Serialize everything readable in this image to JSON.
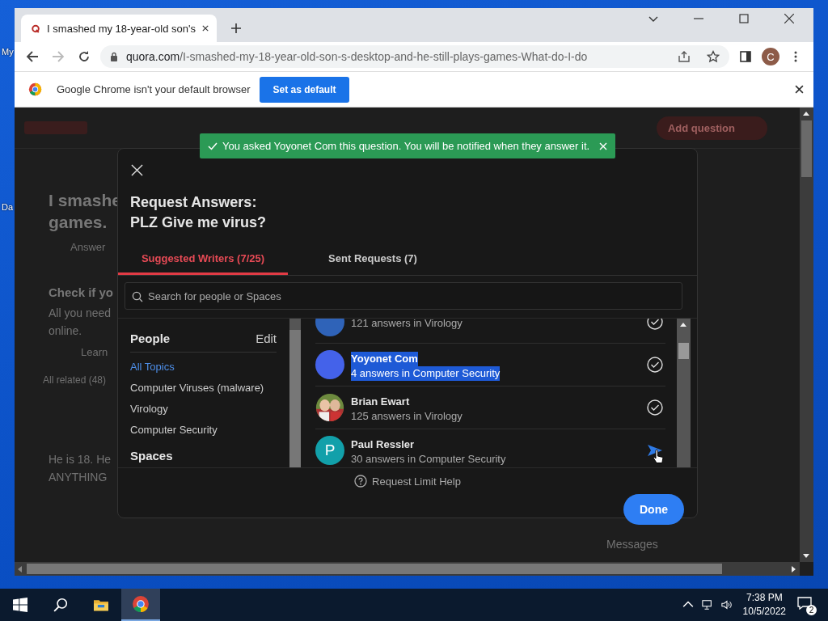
{
  "desktop": {
    "icon_labels": [
      "My",
      "Da"
    ]
  },
  "browser": {
    "tab": {
      "title": "I smashed my 18-year-old son's"
    },
    "address": {
      "domain": "quora.com",
      "path": "/I-smashed-my-18-year-old-son-s-desktop-and-he-still-plays-games-What-do-I-do"
    },
    "profile_initial": "C",
    "infobar": {
      "message": "Google Chrome isn't your default browser",
      "button": "Set as default"
    }
  },
  "page": {
    "header_button": "Add question",
    "messages_label": "Messages",
    "left_texts": [
      {
        "text": "I smashe",
        "kind": "title"
      },
      {
        "text": "games.",
        "kind": "title"
      },
      {
        "text": "Answer",
        "kind": "action"
      },
      {
        "text": "Check if yo",
        "kind": "heading"
      },
      {
        "text": "All you need",
        "kind": "body"
      },
      {
        "text": "online.",
        "kind": "body"
      },
      {
        "text": "Learn",
        "kind": "action"
      },
      {
        "text": "All related (48)",
        "kind": "small"
      },
      {
        "text": "He is 18. He",
        "kind": "body"
      },
      {
        "text": "ANYTHING",
        "kind": "body"
      }
    ]
  },
  "toast": {
    "message": "You asked Yoyonet Com this question. You will be notified when they answer it."
  },
  "modal": {
    "title_lines": [
      "Request Answers:",
      "PLZ Give me virus?"
    ],
    "tabs": [
      {
        "label": "Suggested Writers (7/25)",
        "selected": true
      },
      {
        "label": "Sent Requests (7)",
        "selected": false
      }
    ],
    "search": {
      "placeholder": "Search for people or Spaces"
    },
    "topics": {
      "people_heading": "People",
      "edit": "Edit",
      "spaces_heading": "Spaces",
      "items": [
        {
          "label": "All Topics",
          "selected": true
        },
        {
          "label": "Computer Viruses (malware)",
          "selected": false
        },
        {
          "label": "Virology",
          "selected": false
        },
        {
          "label": "Computer Security",
          "selected": false
        }
      ]
    },
    "writers": [
      {
        "answers": "121 answers in Virology",
        "avatar": {
          "kind": "plain",
          "color": "#2f63b8"
        },
        "requested": true,
        "highlighted": false
      },
      {
        "name": "Yoyonet Com",
        "answers": "4 answers in Computer Security",
        "avatar": {
          "kind": "plain",
          "color": "#4462ea"
        },
        "requested": true,
        "highlighted": true
      },
      {
        "name": "Brian Ewart",
        "answers": "125 answers in Virology",
        "requested": true,
        "highlighted": false
      },
      {
        "name": "Paul Ressler",
        "answers": "30 answers in Computer Security",
        "avatar": {
          "kind": "letter",
          "letter": "P",
          "color": "#12a0aa"
        },
        "requested": false,
        "highlighted": false
      }
    ],
    "help": "Request Limit Help",
    "done": "Done"
  },
  "taskbar": {
    "time": "7:38 PM",
    "date": "10/5/2022",
    "notifications": "2"
  }
}
